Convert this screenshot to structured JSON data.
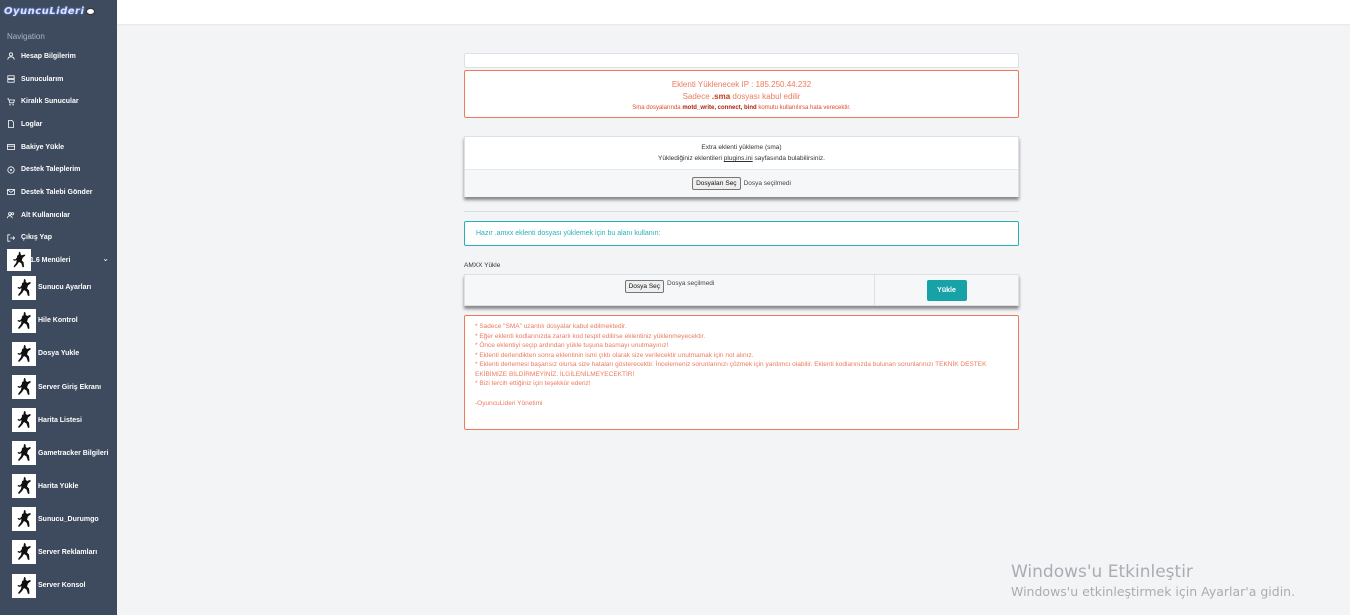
{
  "brand": {
    "logo_text": "OyuncuLideri"
  },
  "sidebar": {
    "heading": "Navigation",
    "items": [
      {
        "label": "Hesap Bilgilerim",
        "icon": "user-icon"
      },
      {
        "label": "Sunucularım",
        "icon": "server-icon"
      },
      {
        "label": "Kiralık Sunucular",
        "icon": "cart-icon"
      },
      {
        "label": "Loglar",
        "icon": "document-icon"
      },
      {
        "label": "Bakiye Yükle",
        "icon": "credit-card-icon"
      },
      {
        "label": "Destek Taleplerim",
        "icon": "help-circle-icon"
      },
      {
        "label": "Destek Talebi Gönder",
        "icon": "mail-icon"
      },
      {
        "label": "Alt Kullanıcılar",
        "icon": "users-icon"
      },
      {
        "label": "Çıkış Yap",
        "icon": "logout-icon"
      }
    ],
    "group": {
      "label": "1.6 Menüleri",
      "icon": "counter-strike-icon",
      "expanded": true
    },
    "sub_items": [
      {
        "label": "Sunucu Ayarları"
      },
      {
        "label": "Hile Kontrol"
      },
      {
        "label": "Dosya Yukle"
      },
      {
        "label": "Server Giriş Ekranı"
      },
      {
        "label": "Harita Listesi"
      },
      {
        "label": "Gametracker Bilgileri"
      },
      {
        "label": "Harita Yükle"
      },
      {
        "label": "Sunucu_Durumgo"
      },
      {
        "label": "Server Reklamları"
      },
      {
        "label": "Server Konsol"
      }
    ]
  },
  "ip_notice": {
    "line1": "Eklenti Yüklenecek IP : 185.250.44.232",
    "line2_prefix": "Sadece ",
    "line2_ext": ".sma",
    "line2_suffix": " dosyası kabul edilir",
    "line3_prefix": "Sma dosyalarında ",
    "line3_cmds": "motd_write, connect, bind",
    "line3_suffix": " komutu kullanılırsa hata verecektir."
  },
  "sma_card": {
    "title": "Extra eklenti yükleme (sma)",
    "sub_prefix": "Yüklediğiniz eklentileri ",
    "sub_link": "plugins.ini",
    "sub_suffix": " sayfasında bulabilirsiniz.",
    "file_button": "Dosyaları Seç",
    "file_status": "Dosya seçilmedi"
  },
  "amxx_notice": "Hazır .amxx eklenti dosyası yüklemek için bu alanı kullanın:",
  "amxx": {
    "label": "AMXX Yükle",
    "file_button": "Dosya Seç",
    "file_status": "Dosya seçilmedi",
    "upload_button": "Yükle",
    "accent": "#17a2a8"
  },
  "rules": [
    "* Sadece \"SMA\" uzantılı dosyalar kabul edilmektedir.",
    "* Eğer eklenti kodlarınızda zararlı kod tespit edilirse eklentiniz yüklenmeyecektir.",
    "* Önce eklentiyi seçip ardından yükle tuşuna basmayı unutmayınız!",
    "* Eklenti derlendikten sonra eklentinin ismi çıktı olarak size verilecektir unutmamak için not alınız.",
    "* Eklenti derlemesi başarısız olursa size hataları gösterecektir. İncelemeniz sorunlarınızı çözmek için yardımcı olabilir. Eklenti kodlarınızda bulunan sorunlarınızı TEKNİK DESTEK EKİBİMİZE BİLDİRMEYİNİZ. İLGİLENİLMEYECEKTİR!",
    "* Bizi tercih ettiğiniz için teşekkür ederiz!"
  ],
  "signature": "-OyuncuLideri Yönetimi",
  "watermark": {
    "title": "Windows'u Etkinleştir",
    "subtitle": "Windows'u etkinleştirmek için Ayarlar'a gidin."
  },
  "colors": {
    "sidebar": "#3e4a5e",
    "warning": "#ee7a5e",
    "teal": "#27b0b8"
  }
}
